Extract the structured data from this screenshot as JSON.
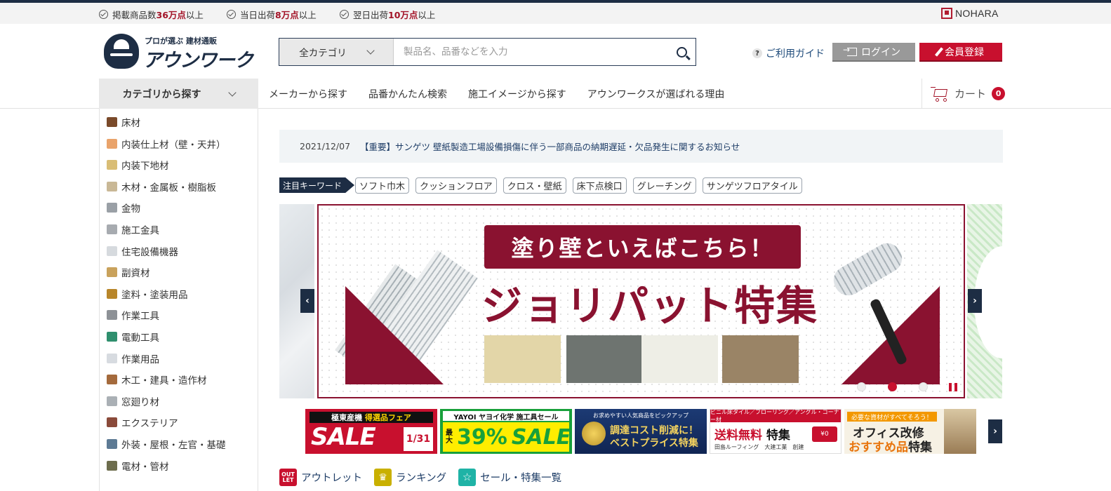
{
  "topbar": {
    "stats": [
      {
        "prefix": "掲載商品数",
        "value": "36万点",
        "suffix": "以上"
      },
      {
        "prefix": "当日出荷",
        "value": "8万点",
        "suffix": "以上"
      },
      {
        "prefix": "翌日出荷",
        "value": "10万点",
        "suffix": "以上"
      }
    ],
    "brand": "NOHARA"
  },
  "header": {
    "logo_sub": "プロが選ぶ 建材通販",
    "logo_main": "アウンワークス",
    "search_category": "全カテゴリ",
    "search_placeholder": "製品名、品番などを入力",
    "guide_label": "ご利用ガイド",
    "login_label": "ログイン",
    "register_label": "会員登録"
  },
  "nav": {
    "category_label": "カテゴリから探す",
    "links": [
      "メーカーから探す",
      "品番かんたん検索",
      "施工イメージから探す",
      "アウンワークスが選ばれる理由"
    ],
    "cart_label": "カート",
    "cart_count": "0"
  },
  "sidebar": {
    "items": [
      {
        "label": "床材",
        "color": "#7a4a2a"
      },
      {
        "label": "内装仕上材（壁・天井）",
        "color": "#e9a36b"
      },
      {
        "label": "内装下地材",
        "color": "#d9bd75"
      },
      {
        "label": "木材・金属板・樹脂板",
        "color": "#c9b896"
      },
      {
        "label": "金物",
        "color": "#9aa0a6"
      },
      {
        "label": "施工金具",
        "color": "#a7abb0"
      },
      {
        "label": "住宅設備機器",
        "color": "#d6dade"
      },
      {
        "label": "副資材",
        "color": "#c9a25c"
      },
      {
        "label": "塗料・塗装用品",
        "color": "#b8862a"
      },
      {
        "label": "作業工具",
        "color": "#8d9196"
      },
      {
        "label": "電動工具",
        "color": "#2f8f6e"
      },
      {
        "label": "作業用品",
        "color": "#d7dbe0"
      },
      {
        "label": "木工・建具・造作材",
        "color": "#a46a3c"
      },
      {
        "label": "窓廻り材",
        "color": "#aab0b5"
      },
      {
        "label": "エクステリア",
        "color": "#8a4a3a"
      },
      {
        "label": "外装・屋根・左官・基礎",
        "color": "#5d7a94"
      },
      {
        "label": "電材・管材",
        "color": "#6d6d4d"
      }
    ]
  },
  "notice": {
    "date": "2021/12/07",
    "text": "【重要】サンゲツ 壁紙製造工場設備損傷に伴う一部商品の納期遅延・欠品発生に関するお知らせ"
  },
  "keywords": {
    "label": "注目キーワード",
    "items": [
      "ソフト巾木",
      "クッションフロア",
      "クロス・壁紙",
      "床下点検口",
      "グレーチング",
      "サンゲツフロアタイル"
    ]
  },
  "carousel": {
    "title": "塗り壁といえばこちら！",
    "main": "ジョリパット特集",
    "swatch_colors": [
      "#e3d6a8",
      "#6e7470",
      "#eeeee6",
      "#9a8466"
    ],
    "active_slide": 2,
    "slide_count": 3
  },
  "subbanners": {
    "b1": {
      "head_a": "極東産機",
      "head_b": "得選品フェア",
      "big": "SALE",
      "date": "1/31"
    },
    "b2": {
      "head": "YAYOI ヤヨイ化学 施工具セール",
      "mini": "最大",
      "pct": "39%",
      "sale": "SALE"
    },
    "b3": {
      "head": "お求めやすい人気商品をピックアップ",
      "t1": "調達コスト削減に！",
      "t2": "ベストプライス特集"
    },
    "b4": {
      "head": "ビニル床タイル／フローリング／アングル・コーナー材",
      "red": "送料無料",
      "black": "特集",
      "truck": "¥0",
      "foot": "田島ルーフィング　大建工業　創建"
    },
    "b5": {
      "head": "必要な資材がすべてそろう！",
      "t1": "オフィス改修",
      "orange": "おすすめ品",
      "black": "特集"
    }
  },
  "bottom_links": [
    {
      "label": "アウトレット",
      "icon": "OUT LET",
      "color": "#c8102e"
    },
    {
      "label": "ランキング",
      "icon": "crown",
      "color": "#c9b000"
    },
    {
      "label": "セール・特集一覧",
      "icon": "star",
      "color": "#1fb3a6"
    }
  ],
  "colors": {
    "brand_navy": "#1d2d44",
    "accent_red": "#c8102e",
    "banner_maroon": "#8a1230"
  }
}
